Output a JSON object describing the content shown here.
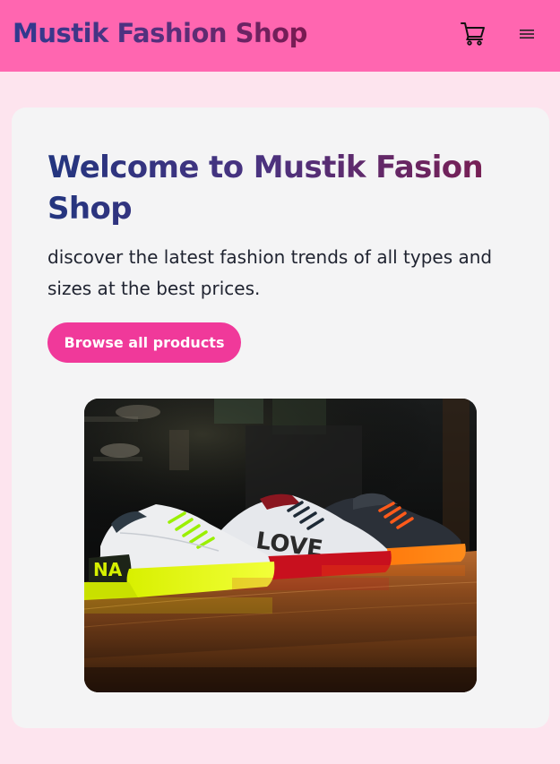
{
  "header": {
    "brand": "Mustik Fashion Shop",
    "cart_icon": "shopping-cart-icon",
    "menu_icon": "hamburger-menu-icon"
  },
  "hero": {
    "title": "Welcome to Mustik Fasion Shop",
    "subtitle": "discover the latest fashion trends of all types and sizes at the best prices.",
    "cta_label": "Browse all products",
    "image_subject": "three sneakers on a wooden shelf",
    "shoe_print_left": "NA",
    "shoe_print_middle": "LOVE"
  },
  "colors": {
    "page_background": "#fde4ee",
    "header_background": "#ff66b0",
    "card_background": "#f4f4f5",
    "button_background": "#f0399a",
    "title_gradient_start": "#23357f",
    "title_gradient_end": "#7d1d4f"
  }
}
